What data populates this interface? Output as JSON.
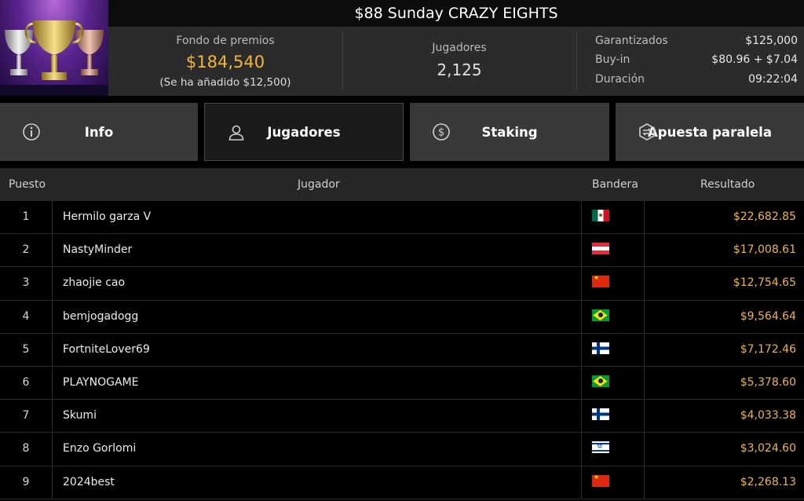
{
  "title": "$88 Sunday CRAZY EIGHTS",
  "prize": {
    "label": "Fondo de premios",
    "value": "$184,540",
    "added": "(Se ha añadido $12,500)"
  },
  "players": {
    "label": "Jugadores",
    "value": "2,125"
  },
  "details": [
    {
      "label": "Garantizados",
      "value": "$125,000"
    },
    {
      "label": "Buy-in",
      "value": "$80.96 + $7.04"
    },
    {
      "label": "Duración",
      "value": "09:22:04"
    }
  ],
  "tabs": [
    {
      "label": "Info",
      "icon": "info-icon",
      "active": false
    },
    {
      "label": "Jugadores",
      "icon": "user-icon",
      "active": true
    },
    {
      "label": "Staking",
      "icon": "dollar-coin-icon",
      "active": false
    },
    {
      "label": "Apuesta paralela",
      "icon": "side-bet-icon",
      "active": false
    }
  ],
  "table": {
    "headers": {
      "rank": "Puesto",
      "player": "Jugador",
      "flag": "Bandera",
      "result": "Resultado"
    },
    "rows": [
      {
        "rank": "1",
        "player": "Hermilo garza V",
        "flag": "mx",
        "result": "$22,682.85"
      },
      {
        "rank": "2",
        "player": "NastyMinder",
        "flag": "at",
        "result": "$17,008.61"
      },
      {
        "rank": "3",
        "player": "zhaojie cao",
        "flag": "cn",
        "result": "$12,754.65"
      },
      {
        "rank": "4",
        "player": "bemjogadogg",
        "flag": "br",
        "result": "$9,564.64"
      },
      {
        "rank": "5",
        "player": "FortniteLover69",
        "flag": "fi",
        "result": "$7,172.46"
      },
      {
        "rank": "6",
        "player": "PLAYNOGAME",
        "flag": "br",
        "result": "$5,378.60"
      },
      {
        "rank": "7",
        "player": "Skumi",
        "flag": "fi",
        "result": "$4,033.38"
      },
      {
        "rank": "8",
        "player": "Enzo Gorlomi",
        "flag": "il",
        "result": "$3,024.60"
      },
      {
        "rank": "9",
        "player": "2024best",
        "flag": "cn",
        "result": "$2,268.13"
      }
    ]
  }
}
